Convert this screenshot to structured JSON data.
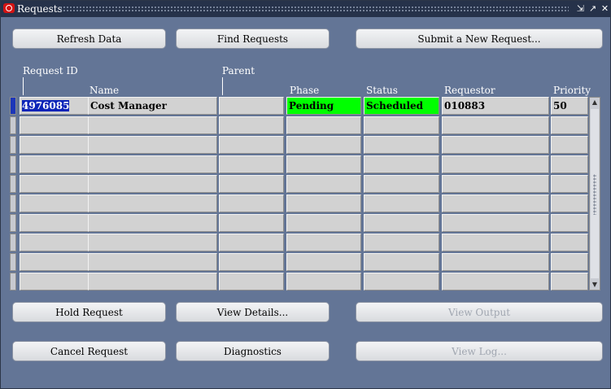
{
  "window": {
    "title": "Requests",
    "controls": {
      "minimize": "⇲",
      "maximize": "↗",
      "close": "✕"
    }
  },
  "toolbar": {
    "refresh_label": "Refresh Data",
    "find_label": "Find Requests",
    "submit_label": "Submit a New Request..."
  },
  "columns": {
    "request_id": "Request ID",
    "parent": "Parent",
    "name": "Name",
    "phase": "Phase",
    "status": "Status",
    "requestor": "Requestor",
    "priority": "Priority"
  },
  "rows": [
    {
      "request_id": "4976085",
      "name": "Cost Manager",
      "parent": "",
      "phase": "Pending",
      "status": "Scheduled",
      "requestor": "010883",
      "priority": "50"
    }
  ],
  "empty_rows": 9,
  "colors": {
    "pending": "#00ff00",
    "scheduled": "#00ff00",
    "selection": "#0b24b8"
  },
  "actions": {
    "hold_label": "Hold Request",
    "details_label": "View Details...",
    "output_label": "View Output",
    "cancel_label": "Cancel Request",
    "diagnostics_label": "Diagnostics",
    "log_label": "View Log..."
  }
}
